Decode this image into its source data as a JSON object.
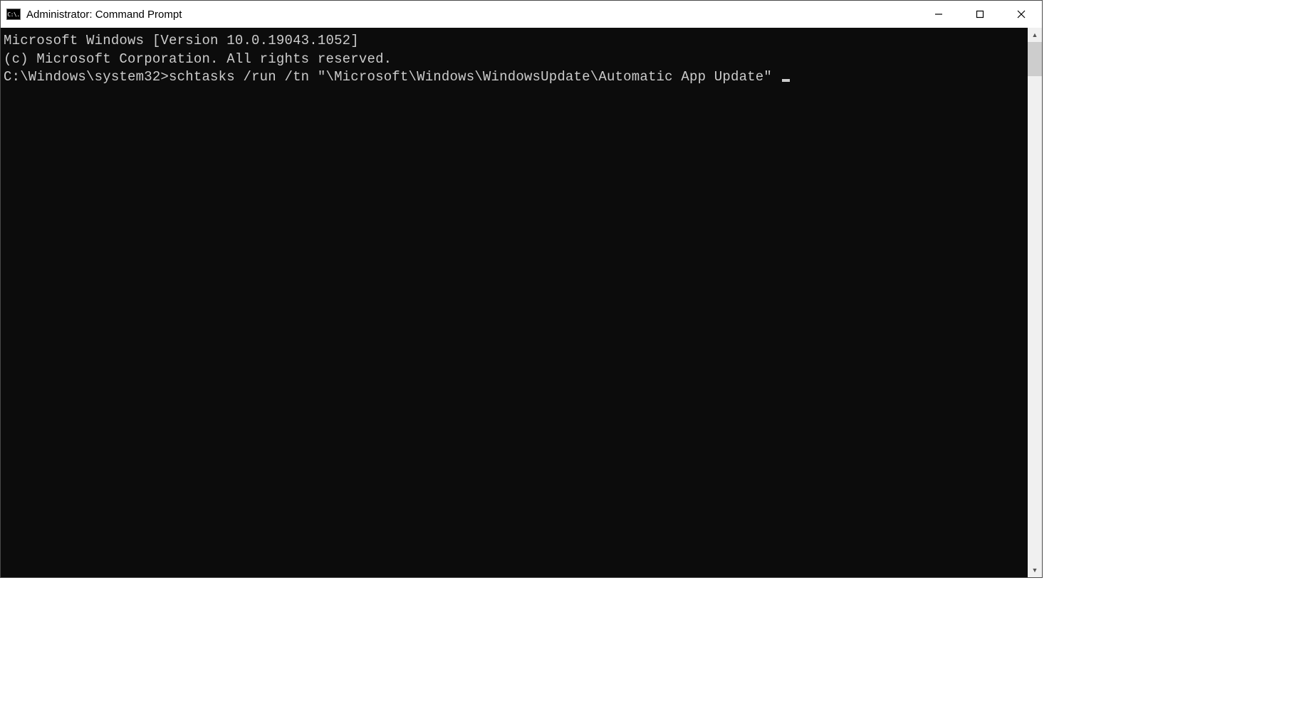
{
  "window": {
    "title": "Administrator: Command Prompt",
    "icon_label": "C:\\."
  },
  "terminal": {
    "line1": "Microsoft Windows [Version 10.0.19043.1052]",
    "line2": "(c) Microsoft Corporation. All rights reserved.",
    "blank": "",
    "prompt": "C:\\Windows\\system32>",
    "command": "schtasks /run /tn \"\\Microsoft\\Windows\\WindowsUpdate\\Automatic App Update\""
  }
}
